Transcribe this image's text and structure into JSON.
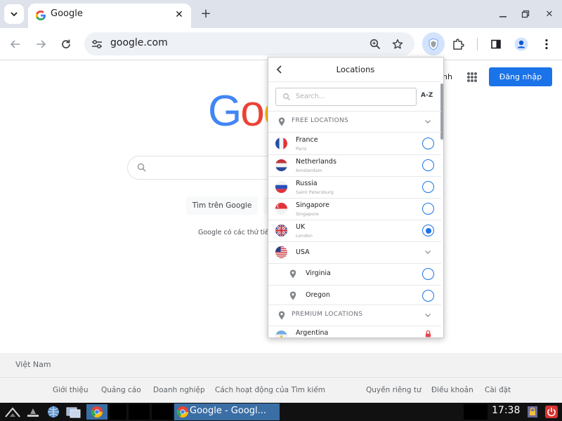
{
  "browser": {
    "tab_title": "Google",
    "url": "google.com"
  },
  "google": {
    "header_partial": "nh",
    "signin_label": "Đăng nhập",
    "logo_partial": "Goo",
    "search_button_label": "Tìm trên Google",
    "offered_text_partial": "Google có các thứ tiếng",
    "country": "Việt Nam",
    "footer_links_left": [
      "Giới thiệu",
      "Quảng cáo",
      "Doanh nghiệp",
      "Cách hoạt động của Tìm kiếm"
    ],
    "footer_links_right": [
      "Quyền riêng tư",
      "Điều khoản",
      "Cài đặt"
    ]
  },
  "vpn_popup": {
    "title": "Locations",
    "search_placeholder": "Search...",
    "sort_label": "A-Z",
    "free_section_label": "FREE LOCATIONS",
    "premium_section_label": "PREMIUM LOCATIONS",
    "free_locations": [
      {
        "name": "France",
        "city": "Paris",
        "flag": "fr",
        "selected": false
      },
      {
        "name": "Netherlands",
        "city": "Amsterdam",
        "flag": "nl",
        "selected": false
      },
      {
        "name": "Russia",
        "city": "Saint Petersburg",
        "flag": "ru",
        "selected": false
      },
      {
        "name": "Singapore",
        "city": "Singapore",
        "flag": "sg",
        "selected": false
      },
      {
        "name": "UK",
        "city": "London",
        "flag": "uk",
        "selected": true
      }
    ],
    "usa": {
      "name": "USA",
      "flag": "us",
      "cities": [
        {
          "name": "Virginia",
          "selected": false
        },
        {
          "name": "Oregon",
          "selected": false
        }
      ]
    },
    "premium_locations": [
      {
        "name": "Argentina",
        "flag": "ar",
        "locked": true
      }
    ]
  },
  "taskbar": {
    "window_title": "Google - Googl...",
    "clock": "17:38"
  },
  "colors": {
    "accent": "#1a73e8",
    "tabstrip": "#dee3eb",
    "taskbar": "#111111",
    "taskbar_active": "#3b6ea5"
  }
}
